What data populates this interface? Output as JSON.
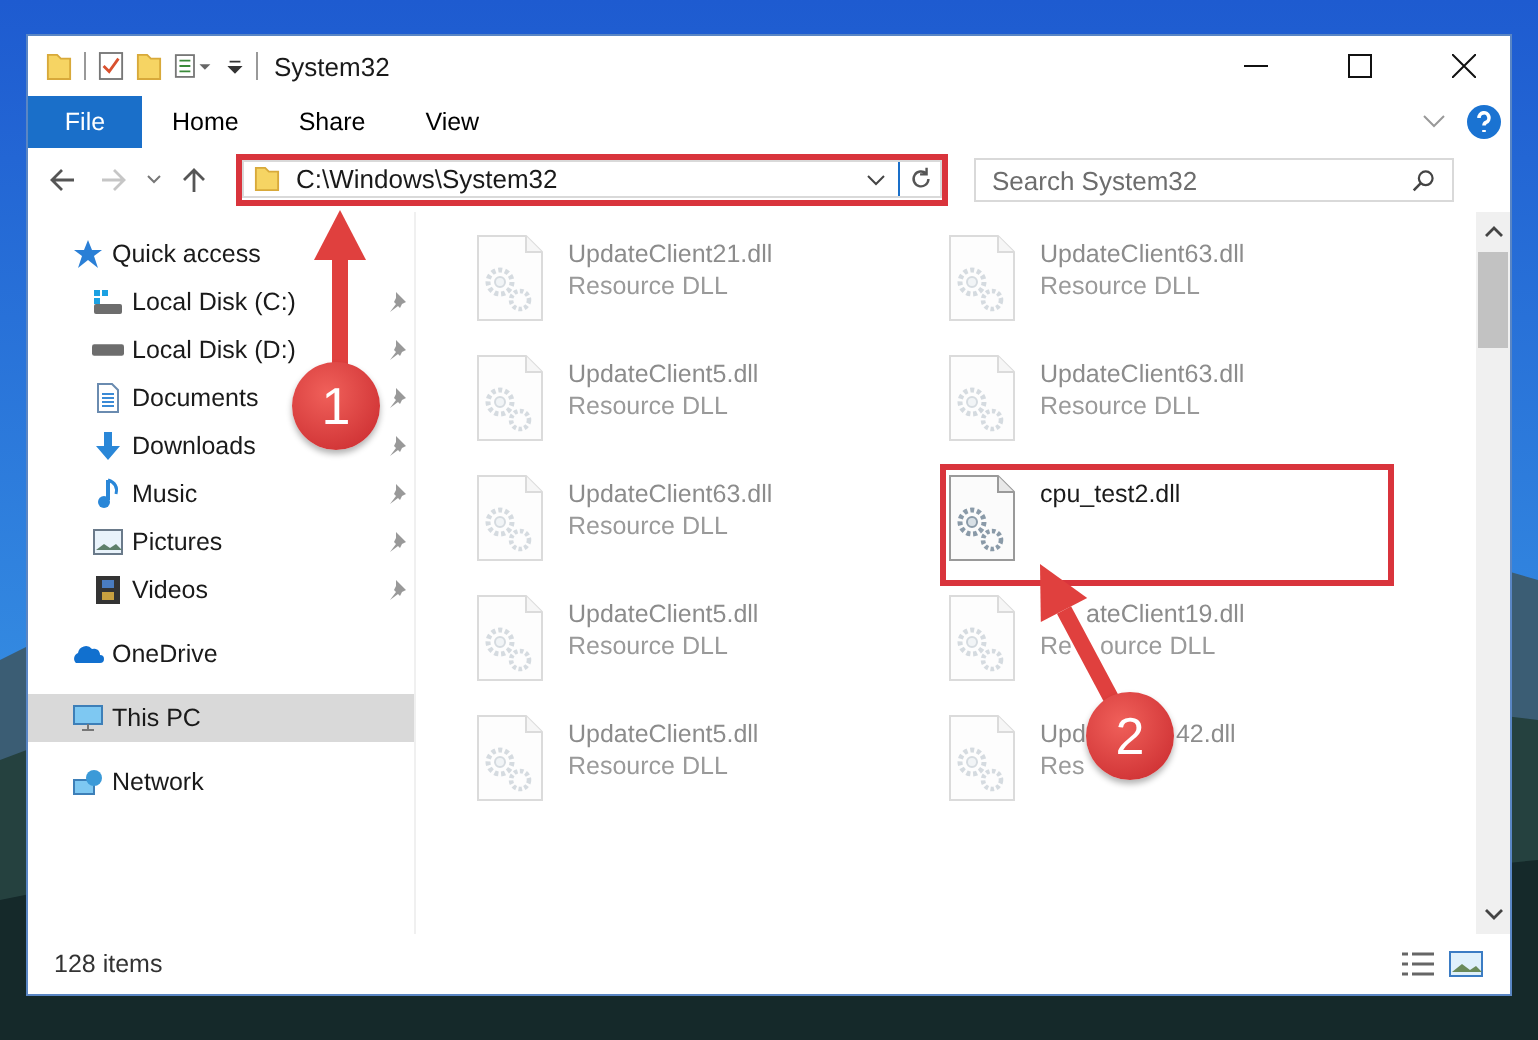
{
  "window": {
    "title": "System32"
  },
  "ribbon_tabs": [
    {
      "label": "File",
      "kind": "file-menu"
    },
    {
      "label": "Home",
      "kind": "tab"
    },
    {
      "label": "Share",
      "kind": "tab"
    },
    {
      "label": "View",
      "kind": "tab"
    }
  ],
  "address_bar": {
    "path": "C:\\Windows\\System32"
  },
  "search": {
    "placeholder": "Search System32"
  },
  "navigation": [
    {
      "label": "Quick access",
      "selected": false,
      "children": [
        {
          "label": "Local Disk (C:)",
          "pinned": true,
          "selected": false
        },
        {
          "label": "Local Disk (D:)",
          "pinned": true,
          "selected": false
        },
        {
          "label": "Documents",
          "pinned": true,
          "selected": false
        },
        {
          "label": "Downloads",
          "pinned": true,
          "selected": false
        },
        {
          "label": "Music",
          "pinned": true,
          "selected": false
        },
        {
          "label": "Pictures",
          "pinned": true,
          "selected": false
        },
        {
          "label": "Videos",
          "pinned": true,
          "selected": false
        }
      ]
    },
    {
      "label": "OneDrive",
      "selected": false
    },
    {
      "label": "This PC",
      "selected": true
    },
    {
      "label": "Network",
      "selected": false
    }
  ],
  "files": [
    {
      "kind": "plain",
      "name": "UpdateClient21.dll",
      "type": "Resource DLL",
      "blurred": true
    },
    {
      "kind": "plain",
      "name": "UpdateClient63.dll",
      "type": "Resource DLL",
      "blurred": true
    },
    {
      "kind": "plain",
      "name": "UpdateClient5.dll",
      "type": "Resource DLL",
      "blurred": true
    },
    {
      "kind": "plain",
      "name": "UpdateClient63.dll",
      "type": "Resource DLL",
      "blurred": true
    },
    {
      "kind": "plain",
      "name": "UpdateClient63.dll",
      "type": "Resource DLL",
      "blurred": true
    },
    {
      "kind": "plain",
      "name": "cpu_test2.dll",
      "blurred": false
    },
    {
      "kind": "plain",
      "name": "UpdateClient5.dll",
      "type": "Resource DLL",
      "blurred": true
    },
    {
      "kind": "covered",
      "name_parts": [
        "ateClient19.dll"
      ],
      "type_parts": [
        "Re",
        "ource DLL"
      ],
      "blurred": true
    },
    {
      "kind": "plain",
      "name": "UpdateClient5.dll",
      "type": "Resource DLL",
      "blurred": true
    },
    {
      "kind": "covered",
      "name_parts": [
        "Upd",
        "42.dll"
      ],
      "type_parts": [
        "Res"
      ],
      "blurred": true
    }
  ],
  "status_bar": {
    "item_count": "128 items"
  },
  "annotations": [
    {
      "number": "1"
    },
    {
      "number": "2"
    }
  ]
}
